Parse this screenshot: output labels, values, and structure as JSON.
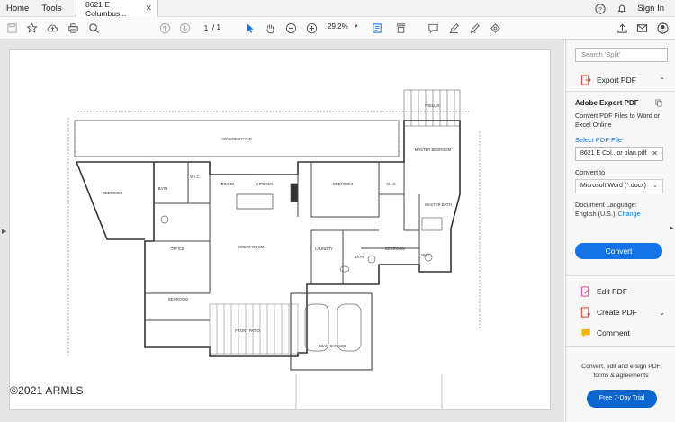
{
  "menubar": {
    "home": "Home",
    "tools": "Tools",
    "doc_tab": "8621 E Columbus...",
    "sign_in": "Sign In"
  },
  "toolbar": {
    "current_page": "1",
    "total_pages": "/ 1",
    "zoom": "29.2%"
  },
  "document": {
    "watermark": "©2021 ARMLS",
    "plan_labels": {
      "covered_patio": "COVERED PATIO",
      "trellis": "TRELLIS",
      "master_bedroom": "MASTER BEDROOM",
      "bedroom_left": "BEDROOM",
      "bath_left": "BATH",
      "wic_left": "W.I.C.",
      "dining": "DINING",
      "kitchen": "KITCHEN",
      "bedroom_mid": "BEDROOM",
      "wic_mid": "W.I.C.",
      "master_bath": "MASTER BATH",
      "office": "OFFICE",
      "great_room": "GREAT ROOM",
      "laundry": "LAUNDRY",
      "bath_mid": "BATH",
      "bedroom_right": "BEDROOM",
      "wic_right": "W.I.C.",
      "bedroom_bottom": "BEDROOM",
      "front_patio": "FRONT PATIO",
      "garage": "2CAR GARAGE"
    }
  },
  "panel": {
    "search_placeholder": "Search 'Split'",
    "export_pdf": "Export PDF",
    "adobe_export_title": "Adobe Export PDF",
    "export_desc": "Convert PDF Files to Word or Excel Online",
    "select_pdf": "Select PDF File",
    "file_name": "8621 E Col...or plan.pdf",
    "convert_to_label": "Convert to",
    "convert_to_value": "Microsoft Word (*.docx)",
    "doc_lang_label": "Document Language:",
    "doc_lang_value": "English (U.S.)",
    "change": "Change",
    "convert_btn": "Convert",
    "edit_pdf": "Edit PDF",
    "create_pdf": "Create PDF",
    "comment": "Comment",
    "promo": "Convert, edit and e-sign PDF forms & agreements",
    "trial_btn": "Free 7-Day Trial"
  },
  "colors": {
    "accent_blue": "#1473e6",
    "export_red": "#e0412f",
    "edit_pink": "#e3458f",
    "create_red": "#e0412f",
    "comment_yellow": "#f5b400"
  }
}
